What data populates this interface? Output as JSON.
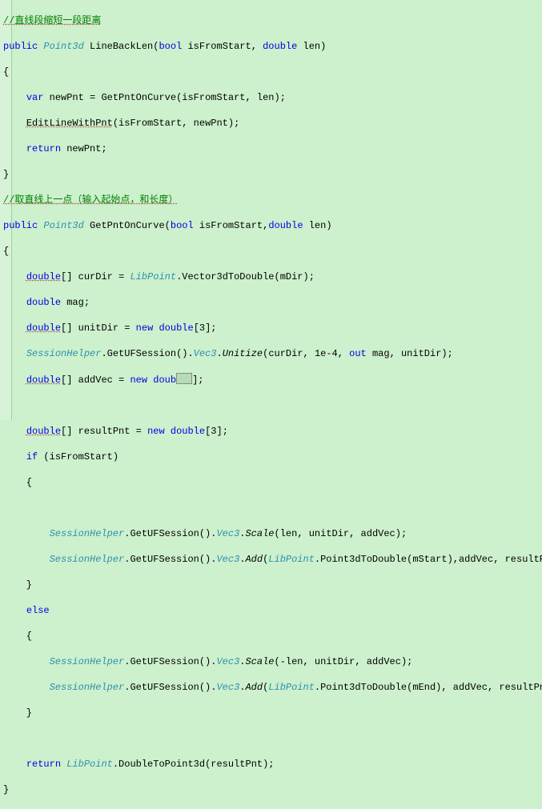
{
  "code": {
    "c1": "//直线段缩短一段距离",
    "m1": {
      "kw_pub": "public",
      "type": "Point3d",
      "name": "LineBackLen",
      "kw_bool": "bool",
      "p1": "isFromStart",
      "kw_dbl": "double",
      "p2": "len"
    },
    "b1": {
      "kw_var": "var",
      "v": "newPnt",
      "m": "GetPntOnCurve",
      "a1": "isFromStart",
      "a2": "len"
    },
    "b2": {
      "m": "EditLineWithPnt",
      "a1": "isFromStart",
      "a2": "newPnt"
    },
    "b3": {
      "kw_ret": "return",
      "v": "newPnt"
    },
    "c2": "//取直线上一点（输入起始点，和长度）",
    "m2": {
      "kw_pub": "public",
      "type": "Point3d",
      "name": "GetPntOnCurve",
      "kw_bool": "bool",
      "p1": "isFromStart",
      "kw_dbl": "double",
      "p2": "len"
    },
    "d1": {
      "kw_dbl": "double",
      "v": "curDir",
      "cls": "LibPoint",
      "m": "Vector3dToDouble",
      "a": "mDir"
    },
    "d2": {
      "kw_dbl": "double",
      "v": "mag"
    },
    "d3": {
      "kw_dbl": "double",
      "v": "unitDir",
      "kw_new": "new",
      "kw_dbl2": "double",
      "sz": "3"
    },
    "d4": {
      "cls": "SessionHelper",
      "m1": "GetUFSession",
      "prop": "Vec3",
      "m2": "Unitize",
      "a1": "curDir",
      "a2": "1e-4",
      "kw_out": "out",
      "a3": "mag",
      "a4": "unitDir"
    },
    "d5": {
      "kw_dbl": "double",
      "v": "addVec",
      "kw_new": "new",
      "kw_dbl2": "doub"
    },
    "d6": {
      "kw_dbl": "double",
      "v": "resultPnt",
      "kw_new": "new",
      "kw_dbl2": "double",
      "sz": "3"
    },
    "d7": {
      "kw_if": "if",
      "cond": "isFromStart"
    },
    "s1": {
      "cls": "SessionHelper",
      "m1": "GetUFSession",
      "prop": "Vec3",
      "m2": "Scale",
      "a1": "len",
      "a2": "unitDir",
      "a3": "addVec"
    },
    "s2": {
      "cls": "SessionHelper",
      "m1": "GetUFSession",
      "prop": "Vec3",
      "m2": "Add",
      "cls2": "LibPoint",
      "m3": "Point3dToDouble",
      "a1": "mStart",
      "a2": "addVec",
      "a3": "resultPnt"
    },
    "kw_else": "else",
    "s3": {
      "cls": "SessionHelper",
      "m1": "GetUFSession",
      "prop": "Vec3",
      "m2": "Scale",
      "a1": "-len",
      "a2": "unitDir",
      "a3": "addVec"
    },
    "s4": {
      "cls": "SessionHelper",
      "m1": "GetUFSession",
      "prop": "Vec3",
      "m2": "Add",
      "cls2": "LibPoint",
      "m3": "Point3dToDouble",
      "a1": "mEnd",
      "a2": "addVec",
      "a3": "resultPnt"
    },
    "r2": {
      "kw_ret": "return",
      "cls": "LibPoint",
      "m": "DoubleToPoint3d",
      "a": "resultPnt"
    }
  }
}
